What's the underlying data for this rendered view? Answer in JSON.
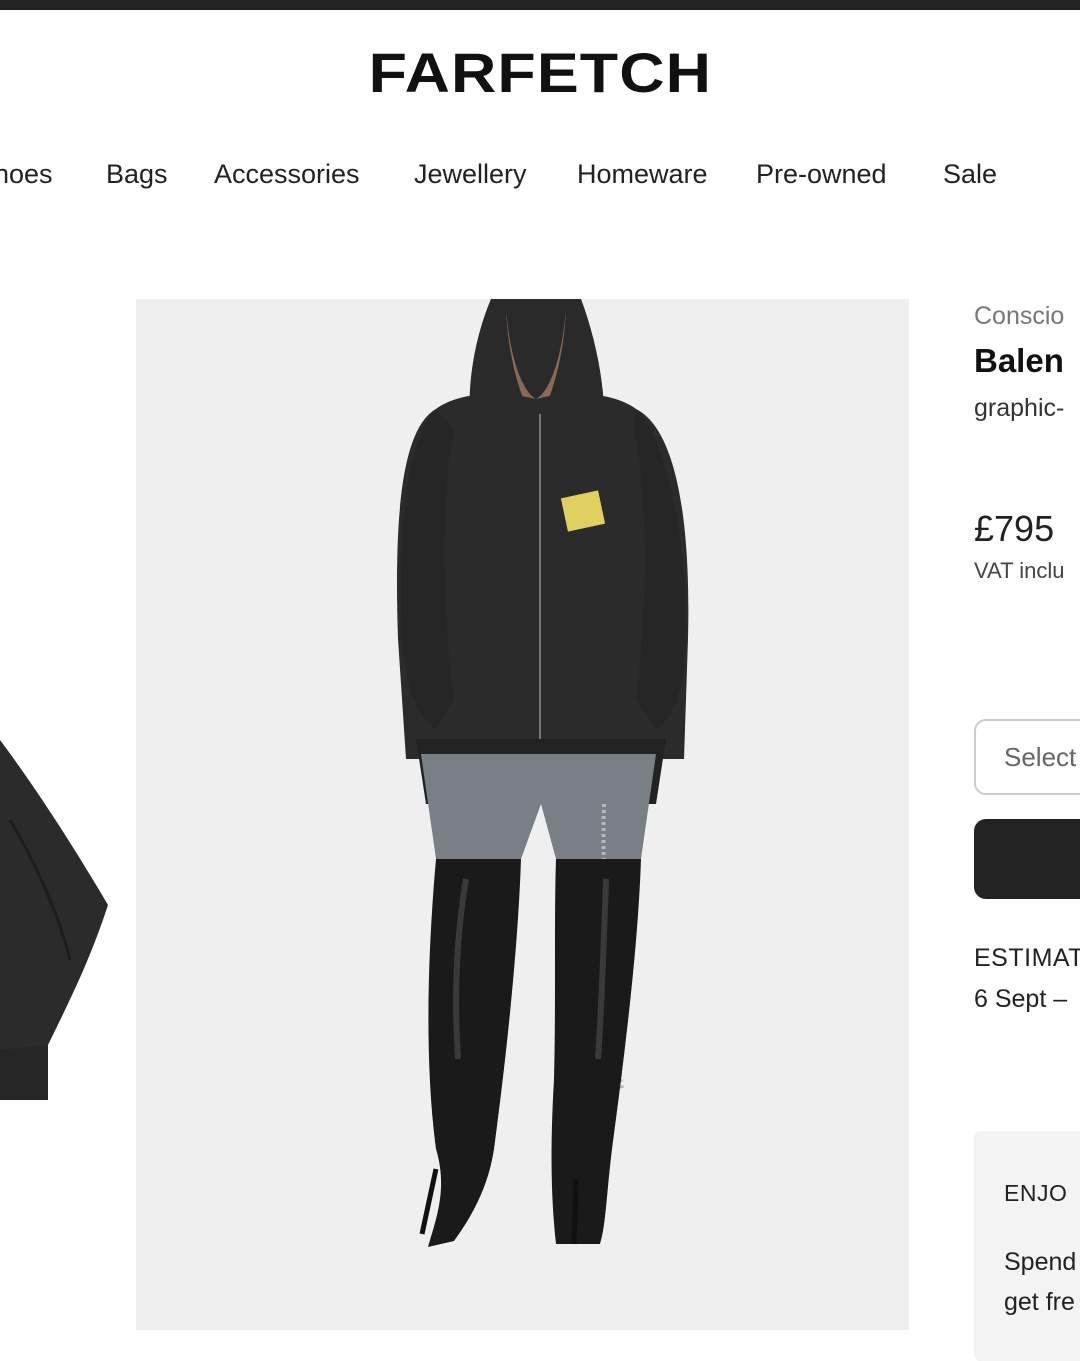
{
  "header": {
    "logo": "FARFETCH"
  },
  "nav": {
    "items": [
      "hoes",
      "Bags",
      "Accessories",
      "Jewellery",
      "Homeware",
      "Pre-owned",
      "Sale"
    ]
  },
  "product": {
    "tag_line": "Conscio",
    "designer": "Balen",
    "description": "graphic-",
    "price": "£795",
    "vat_note": "VAT inclu",
    "size_placeholder": "Select",
    "estimated_label": "ESTIMAT",
    "estimated_date": "6 Sept –"
  },
  "promo": {
    "title": "ENJO",
    "line1": "Spend",
    "line2": "get fre"
  },
  "colors": {
    "accent": "#222222",
    "image_bg": "#eeeeee",
    "panel_bg": "#f3f3f3"
  },
  "icons": {
    "gallery_thumb": "hoodie-sleeve-image",
    "main_image": "model-hoodie-image"
  }
}
